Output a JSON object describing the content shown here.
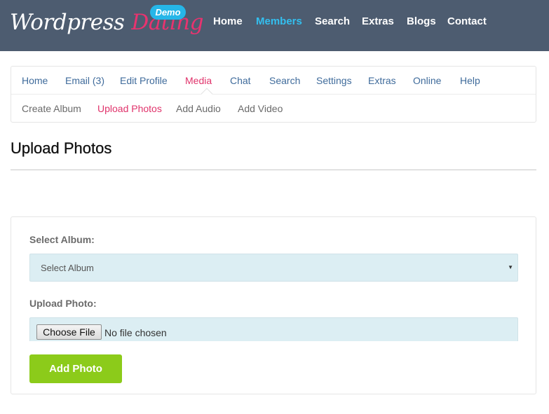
{
  "header": {
    "logo_word1": "Wordpress",
    "logo_word2": "Dating",
    "demo_badge": "Demo",
    "nav": [
      {
        "label": "Home",
        "active": false
      },
      {
        "label": "Members",
        "active": true
      },
      {
        "label": "Search",
        "active": false
      },
      {
        "label": "Extras",
        "active": false
      },
      {
        "label": "Blogs",
        "active": false
      },
      {
        "label": "Contact",
        "active": false
      }
    ]
  },
  "member_nav": [
    {
      "label": "Home",
      "active": false
    },
    {
      "label": "Email (3)",
      "active": false
    },
    {
      "label": "Edit Profile",
      "active": false
    },
    {
      "label": "Media",
      "active": true
    },
    {
      "label": "Chat",
      "active": false
    },
    {
      "label": "Search",
      "active": false
    },
    {
      "label": "Settings",
      "active": false
    },
    {
      "label": "Extras",
      "active": false
    },
    {
      "label": "Online",
      "active": false
    },
    {
      "label": "Help",
      "active": false
    }
  ],
  "media_subnav": [
    {
      "label": "Create Album",
      "active": false
    },
    {
      "label": "Upload Photos",
      "active": true
    },
    {
      "label": "Add Audio",
      "active": false
    },
    {
      "label": "Add Video",
      "active": false
    }
  ],
  "page": {
    "title": "Upload Photos"
  },
  "form": {
    "album_label": "Select Album:",
    "album_value": "Select Album",
    "photo_label": "Upload Photo:",
    "choose_file_label": "Choose File",
    "no_file_text": "No file chosen",
    "submit_label": "Add Photo"
  },
  "colors": {
    "header_bg": "#4d5c70",
    "accent_blue": "#33bfef",
    "accent_pink": "#e0336b",
    "button_green": "#8ccb1a",
    "field_bg": "#dceef3"
  }
}
